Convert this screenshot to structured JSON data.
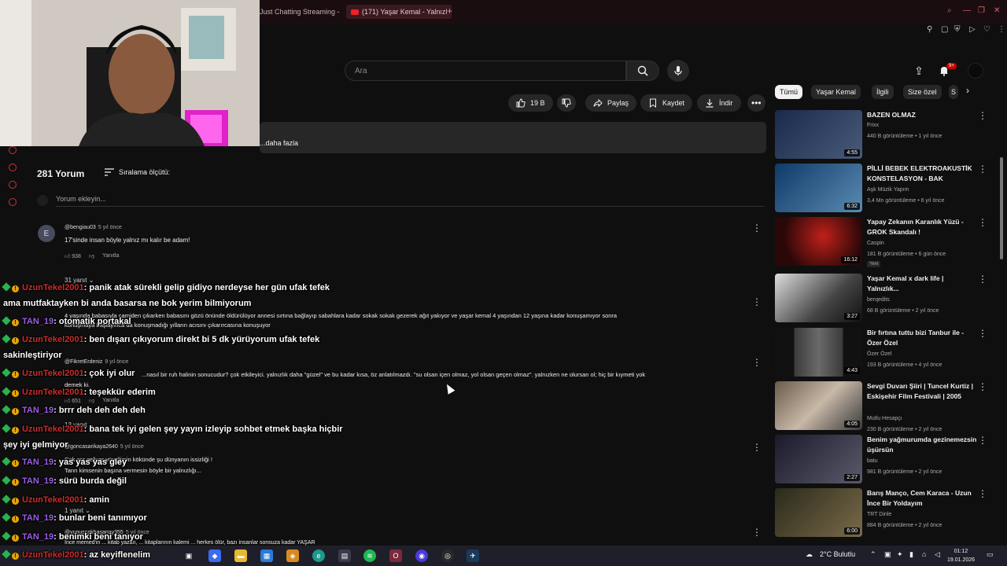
{
  "browser": {
    "tabs": [
      {
        "label": "Just Chatting Streaming -",
        "active": false
      },
      {
        "label": "(171) Yaşar Kemal - Yalnızl",
        "active": true
      }
    ]
  },
  "header": {
    "search_placeholder": "Ara",
    "notif_count": "9+"
  },
  "actions": {
    "like_count": "19 B",
    "share": "Paylaş",
    "save": "Kaydet",
    "download": "İndir"
  },
  "description": {
    "more": "...daha fazla"
  },
  "comments": {
    "count": "281 Yorum",
    "sort_label": "Sıralama ölçütü:",
    "add_placeholder": "Yorum ekleyin...",
    "reply_label": "Yanıtla",
    "items": [
      {
        "avatar": "E",
        "user": "@bengiau03",
        "time": "5 yıl önce",
        "text": "17'sinde insan böyle yalnız mı kalır be adam!",
        "likes": "938",
        "replies": "31 yanıt"
      },
      {
        "avatar": "",
        "user": "",
        "time": "",
        "text": "4 yaşında babasıyla camiden çıkarken babasını gözü önünde öldürülüyor annesi sırtına bağlayıp sabahlara kadar sokak sokak gezerek ağıt yakıyor ve yaşar kemal 4 yaşından 12 yaşına kadar konuşamıyor sonra",
        "text2": "konuşmaya başlayınca da konuşmadığı yılların acısını çıkarırcasına konuşuyor",
        "likes": "",
        "replies": ""
      },
      {
        "avatar": "",
        "user": "@FikretErdeniz",
        "time": "9 yıl önce",
        "text": "...nasıl bir ruh halinin sonucudur? çok etkileyici. yalnızlık daha \"güzel\" ve bu kadar kısa, öz anlatılmazdı. \"su olsan içen olmaz, yol olsan geçen olmaz\". yalnızken ne olursan ol; hiç bir kıymeti yok",
        "text2": "demek ki.",
        "likes": "651",
        "replies": "13 yanıt"
      },
      {
        "avatar": "",
        "user": "@goncasarikaya2640",
        "time": "5 yıl önce",
        "text": "Çok zor geliyor yüreğimin kökünde şu dünyanın issizliği !",
        "text2": "Tanrı kimsenin başına vermesin böyle bir yalnızlığı...",
        "likes": "",
        "replies": "1 yanıt"
      },
      {
        "avatar": "",
        "user": "@yunuscakhasanay355",
        "time": "5 yıl önce",
        "text": "İnce memed'in ... kitab yazan, ... kitaplarının kalemi ... herkes ölür, bazı insanlar sonsuza kadar YAŞAR",
        "likes": "",
        "replies": ""
      }
    ]
  },
  "sidebar": {
    "chips": [
      "Tümü",
      "Yaşar Kemal",
      "İlgili",
      "Size özel",
      "S"
    ],
    "videos": [
      {
        "title": "BAZEN OLMAZ",
        "channel": "Frixx",
        "meta": "440 B görüntüleme • 1 yıl önce",
        "duration": "4:55",
        "thumb": "#3a4a6a"
      },
      {
        "title": "PİLLİ BEBEK ELEKTROAKUSTİK KONSTELASYON - BAK",
        "channel": "Aşk Müzik Yapım",
        "meta": "3,4 Mn görüntüleme • 6 yıl önce",
        "duration": "6:32",
        "thumb": "#2a5a8a"
      },
      {
        "title": "Yapay Zekanın Karanlık Yüzü - GROK Skandalı !",
        "channel": "Caspin",
        "meta": "181 B görüntüleme • 6 gün önce",
        "duration": "16:12",
        "badge": "Yeni",
        "thumb": "#4a1010"
      },
      {
        "title": "Yaşar Kemal x dark life | Yalnızlık...",
        "channel": "berqedits",
        "meta": "68 B görüntüleme • 2 yıl önce",
        "duration": "3:27",
        "thumb": "#2a2a2a"
      },
      {
        "title": "Bir fırtına tuttu bizi Tanbur ile - Özer Özel",
        "channel": "Özer Özel",
        "meta": "193 B görüntüleme • 4 yıl önce",
        "duration": "4:43",
        "thumb": "#101010"
      },
      {
        "title": "Sevgi Duvarı Şiiri | Tuncel Kurtiz | Eskişehir Film Festivali | 2005",
        "channel": "Mutlu Hesapçı",
        "meta": "230 B görüntüleme • 2 yıl önce",
        "duration": "4:05",
        "thumb": "#5a4a3a"
      },
      {
        "title": "Benim yağmurumda gezinemezsin üşürsün",
        "channel": "batu",
        "meta": "981 B görüntüleme • 2 yıl önce",
        "duration": "2:27",
        "thumb": "#2a2a3a"
      },
      {
        "title": "Barış Manço, Cem Karaca - Uzun İnce Bir Yoldayım",
        "channel": "TRT Dinle",
        "meta": "884 B görüntüleme • 2 yıl önce",
        "duration": "6:00",
        "thumb": "#3a3a2a"
      }
    ]
  },
  "chat": [
    {
      "user": "UzunTekel2001",
      "color": "#cc2d2d",
      "msg": ": panik atak sürekli gelip gidiyo nerdeyse her gün ufak tefek",
      "cont": "ama mutfaktayken bi anda basarsa ne bok yerim bilmiyorum"
    },
    {
      "user": "TAN_19",
      "color": "#9b5de5",
      "msg": ": otomatik portakal"
    },
    {
      "user": "UzunTekel2001",
      "color": "#cc2d2d",
      "msg": ": ben dışarı çıkıyorum direkt bi 5 dk yürüyorum ufak tefek",
      "cont": "sakinleştiriyor"
    },
    {
      "user": "UzunTekel2001",
      "color": "#cc2d2d",
      "msg": ": çok iyi olur"
    },
    {
      "user": "UzunTekel2001",
      "color": "#cc2d2d",
      "msg": ": teşekkür ederim"
    },
    {
      "user": "TAN_19",
      "color": "#9b5de5",
      "msg": ": brrr deh deh deh deh"
    },
    {
      "user": "UzunTekel2001",
      "color": "#cc2d2d",
      "msg": ": bana tek iyi gelen şey yayın izleyip sohbet etmek başka hiçbir",
      "cont": "şey iyi gelmiyor"
    },
    {
      "user": "TAN_19",
      "color": "#9b5de5",
      "msg": ": yas yas yas gley"
    },
    {
      "user": "TAN_19",
      "color": "#9b5de5",
      "msg": ": sürü burda değil"
    },
    {
      "user": "UzunTekel2001",
      "color": "#cc2d2d",
      "msg": ": amin"
    },
    {
      "user": "TAN_19",
      "color": "#9b5de5",
      "msg": ": bunlar beni tanımıyor"
    },
    {
      "user": "TAN_19",
      "color": "#9b5de5",
      "msg": ": benimki beni tanıyor"
    },
    {
      "user": "UzunTekel2001",
      "color": "#cc2d2d",
      "msg": ": az keyiflenelim"
    }
  ],
  "taskbar": {
    "weather": "2°C Bulutlu",
    "time": "01:12",
    "date": "19.01.2026"
  }
}
